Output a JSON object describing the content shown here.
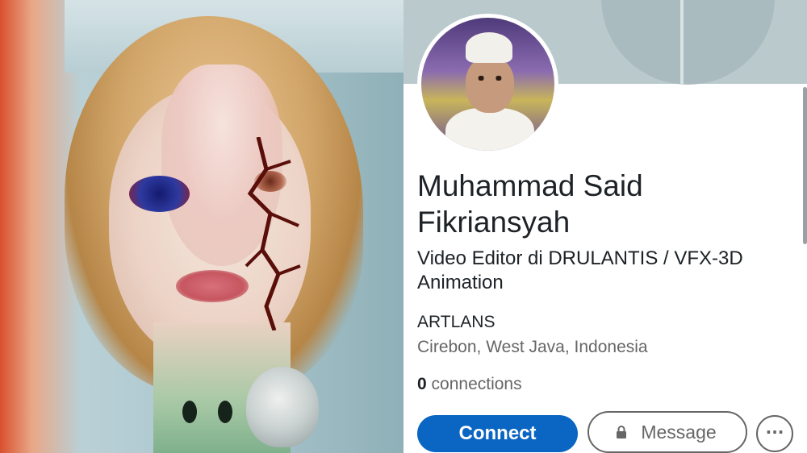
{
  "profile": {
    "name": "Muhammad Said Fikriansyah",
    "headline": "Video Editor di DRULANTIS / VFX-3D Animation",
    "company": "ARTLANS",
    "location": "Cirebon, West Java, Indonesia",
    "connections_count": "0",
    "connections_label": "connections"
  },
  "actions": {
    "connect_label": "Connect",
    "message_label": "Message",
    "more_label": "···"
  },
  "icons": {
    "message": "lock-icon",
    "more": "more-options-icon"
  },
  "colors": {
    "primary": "#0a66c2",
    "text": "#1d2226",
    "muted": "#666666"
  }
}
